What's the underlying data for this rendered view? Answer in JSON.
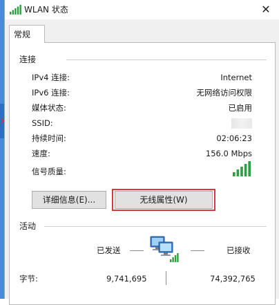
{
  "window": {
    "title": "WLAN 状态",
    "close_glyph": "✕"
  },
  "tabs": [
    {
      "label": "常规"
    }
  ],
  "connection": {
    "section_label": "连接",
    "rows": [
      {
        "label": "IPv4 连接:",
        "value": "Internet"
      },
      {
        "label": "IPv6 连接:",
        "value": "无网络访问权限"
      },
      {
        "label": "媒体状态:",
        "value": "已启用"
      },
      {
        "label": "SSID:",
        "value": ""
      },
      {
        "label": "持续时间:",
        "value": "02:06:23"
      },
      {
        "label": "速度:",
        "value": "156.0 Mbps"
      },
      {
        "label": "信号质量:",
        "value": ""
      }
    ],
    "signal_bars": 5
  },
  "buttons": {
    "details": "详细信息(E)...",
    "wireless_properties": "无线属性(W)"
  },
  "activity": {
    "section_label": "活动",
    "sent_label": "已发送",
    "received_label": "已接收",
    "bytes_label": "字节:",
    "bytes_sent": "9,741,695",
    "bytes_received": "74,392,765"
  },
  "colors": {
    "signal_green": "#2e9e3f",
    "highlight_red": "#d9383a",
    "desktop_blue": "#4a8bd6"
  },
  "icons": {
    "title": "wifi-signal-icon",
    "network": "network-computers-icon",
    "close": "close-icon"
  }
}
